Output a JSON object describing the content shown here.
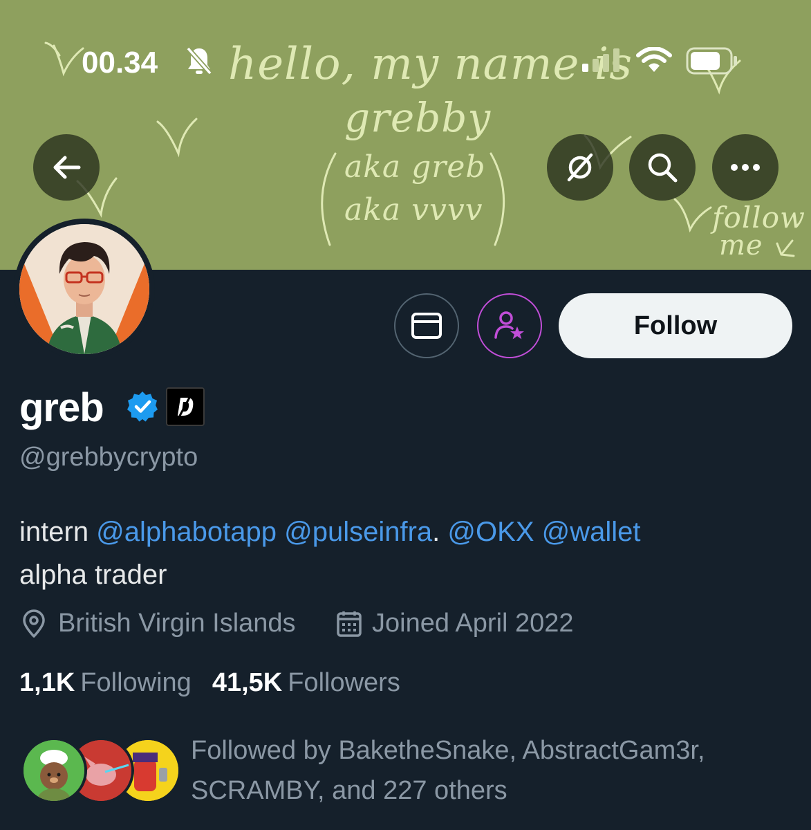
{
  "status_bar": {
    "time": "00.34"
  },
  "banner": {
    "line1": "hello, my name is",
    "line2": "grebby",
    "line3": "aka greb",
    "line4": "aka vvvv",
    "line5": "follow",
    "line6": "me"
  },
  "profile": {
    "display_name": "greb",
    "handle": "@grebbycrypto",
    "bio": {
      "intro": "intern ",
      "mention1": "@alphabotapp",
      "mention2": "@pulseinfra",
      "after_mention2": ".",
      "mention3": "@OKX",
      "mention4": "@wallet",
      "line2": "alpha trader"
    },
    "location": "British Virgin Islands",
    "joined": "Joined April 2022",
    "following_count": "1,1K",
    "following_label": "Following",
    "followers_count": "41,5K",
    "followers_label": "Followers",
    "followed_by": "Followed by BaketheSnake, AbstractGam3r, SCRAMBY, and 227 others"
  },
  "actions": {
    "follow_label": "Follow"
  },
  "colors": {
    "banner": "#8ea05e",
    "background": "#15202b",
    "mention": "#4a99e9",
    "verified": "#1d9bf0",
    "subscribe_ring": "#c14ed8"
  }
}
